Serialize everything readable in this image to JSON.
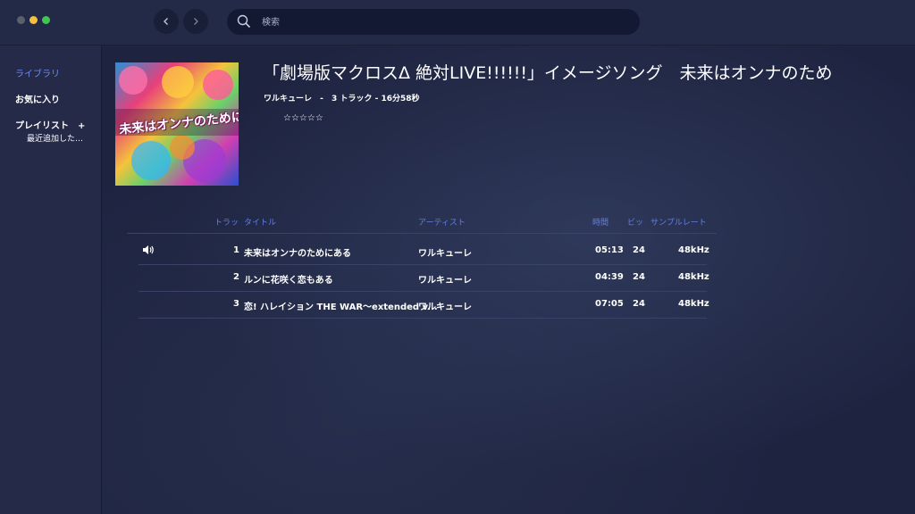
{
  "search": {
    "placeholder": "検索"
  },
  "sidebar": {
    "library": "ライブラリ",
    "favorites": "お気に入り",
    "playlists": "プレイリスト",
    "add": "+",
    "recent": "最近追加した…"
  },
  "album": {
    "title": "「劇場版マクロスΔ 絶対LIVE!!!!!!」イメージソング　未来はオンナのため",
    "artist": "ワルキューレ",
    "separator": "-",
    "tracks": "3 トラック - 16分58秒",
    "rating": "☆☆☆☆☆",
    "cover_text": "未来はオンナのためにある"
  },
  "table": {
    "headers": {
      "track": "トラッ",
      "title": "タイトル",
      "artist": "アーティスト",
      "time": "時間",
      "bit": "ビッ",
      "rate": "サンプルレート"
    },
    "rows": [
      {
        "no": "1",
        "title": "未来はオンナのためにある",
        "artist": "ワルキューレ",
        "time": "05:13",
        "bit": "24",
        "rate": "48kHz",
        "playing": true
      },
      {
        "no": "2",
        "title": "ルンに花咲く恋もある",
        "artist": "ワルキューレ",
        "time": "04:39",
        "bit": "24",
        "rate": "48kHz",
        "playing": false
      },
      {
        "no": "3",
        "title": "恋! ハレイション THE WAR〜extended v...",
        "artist": "ワルキューレ",
        "time": "07:05",
        "bit": "24",
        "rate": "48kHz",
        "playing": false
      }
    ]
  },
  "icons": {
    "back": "chevron-left-icon",
    "forward": "chevron-right-icon",
    "search": "search-icon",
    "speaker": "speaker-icon"
  },
  "colors": {
    "accent": "#6f8cf0",
    "header_text": "#5f7fe8",
    "background": "#1e2440",
    "sidebar": "#242a48"
  }
}
